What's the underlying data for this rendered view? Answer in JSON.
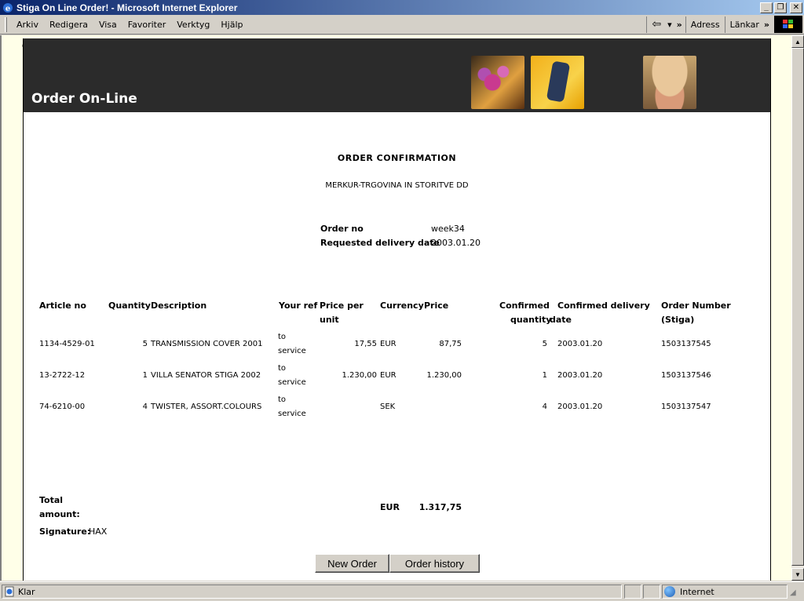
{
  "window": {
    "title": "Stiga On Line Order! - Microsoft Internet Explorer",
    "minimize": "_",
    "restore": "❐",
    "close": "✕"
  },
  "menu": {
    "items": [
      "Arkiv",
      "Redigera",
      "Visa",
      "Favoriter",
      "Verktyg",
      "Hjälp"
    ],
    "back_arrow": "⇦",
    "dropdown": "▾",
    "more": "»",
    "address_label": "Adress",
    "links_label": "Länkar",
    "links_more": "»"
  },
  "page": {
    "stray_char": "e",
    "header_title": "Order On-Line",
    "confirmation_title": "ORDER CONFIRMATION",
    "company": "MERKUR-TRGOVINA IN STORITVE DD",
    "order_no_label": "Order no",
    "order_no_value": "week34",
    "delivery_label": "Requested delivery date",
    "delivery_value": "2003.01.20"
  },
  "table": {
    "headers": {
      "article_no": "Article no",
      "quantity": "Quantity",
      "description": "Description",
      "your_ref": "Your ref",
      "price_per_unit_1": "Price per",
      "price_per_unit_2": "unit",
      "currency": "Currency",
      "price": "Price",
      "confirmed_qty_1": "Confirmed",
      "confirmed_qty_2": "quantity",
      "confirmed_delivery_1": "Confirmed delivery",
      "confirmed_delivery_2": "date",
      "order_number_1": "Order Number",
      "order_number_2": "(Stiga)"
    },
    "rows": [
      {
        "article_no": "1134-4529-01",
        "quantity": "5",
        "description": "TRANSMISSION COVER 2001",
        "your_ref_1": "to",
        "your_ref_2": "service",
        "price_per_unit": "17,55",
        "currency": "EUR",
        "price": "87,75",
        "confirmed_quantity": "5",
        "confirmed_delivery": "2003.01.20",
        "order_number": "1503137545"
      },
      {
        "article_no": "13-2722-12",
        "quantity": "1",
        "description": "VILLA SENATOR STIGA 2002",
        "your_ref_1": "to",
        "your_ref_2": "service",
        "price_per_unit": "1.230,00",
        "currency": "EUR",
        "price": "1.230,00",
        "confirmed_quantity": "1",
        "confirmed_delivery": "2003.01.20",
        "order_number": "1503137546"
      },
      {
        "article_no": "74-6210-00",
        "quantity": "4",
        "description": "TWISTER, ASSORT.COLOURS",
        "your_ref_1": "to",
        "your_ref_2": "service",
        "price_per_unit": "",
        "currency": "SEK",
        "price": "",
        "confirmed_quantity": "4",
        "confirmed_delivery": "2003.01.20",
        "order_number": "1503137547"
      }
    ]
  },
  "totals": {
    "total_label_1": "Total",
    "total_label_2": "amount:",
    "currency": "EUR",
    "amount": "1.317,75",
    "signature_label": "Signature:",
    "signature_value": "HAX"
  },
  "buttons": {
    "new_order": "New Order",
    "order_history": "Order history"
  },
  "status": {
    "text": "Klar",
    "zone": "Internet"
  }
}
